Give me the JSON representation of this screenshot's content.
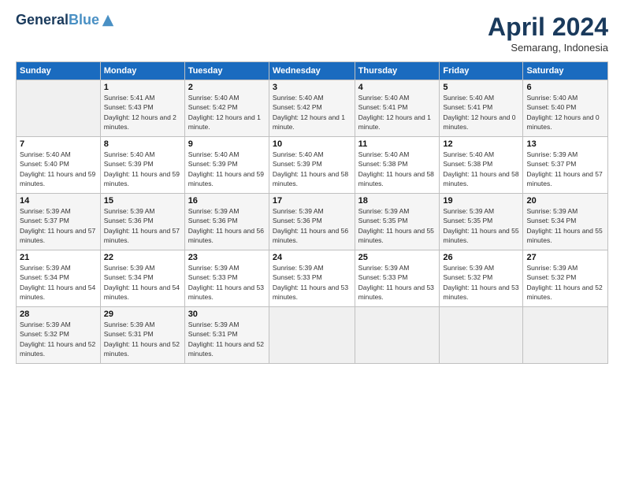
{
  "header": {
    "logo_line1": "General",
    "logo_line2": "Blue",
    "month_title": "April 2024",
    "subtitle": "Semarang, Indonesia"
  },
  "days_of_week": [
    "Sunday",
    "Monday",
    "Tuesday",
    "Wednesday",
    "Thursday",
    "Friday",
    "Saturday"
  ],
  "weeks": [
    [
      {
        "day": "",
        "sunrise": "",
        "sunset": "",
        "daylight": ""
      },
      {
        "day": "1",
        "sunrise": "5:41 AM",
        "sunset": "5:43 PM",
        "daylight": "12 hours and 2 minutes."
      },
      {
        "day": "2",
        "sunrise": "5:40 AM",
        "sunset": "5:42 PM",
        "daylight": "12 hours and 1 minute."
      },
      {
        "day": "3",
        "sunrise": "5:40 AM",
        "sunset": "5:42 PM",
        "daylight": "12 hours and 1 minute."
      },
      {
        "day": "4",
        "sunrise": "5:40 AM",
        "sunset": "5:41 PM",
        "daylight": "12 hours and 1 minute."
      },
      {
        "day": "5",
        "sunrise": "5:40 AM",
        "sunset": "5:41 PM",
        "daylight": "12 hours and 0 minutes."
      },
      {
        "day": "6",
        "sunrise": "5:40 AM",
        "sunset": "5:40 PM",
        "daylight": "12 hours and 0 minutes."
      }
    ],
    [
      {
        "day": "7",
        "sunrise": "5:40 AM",
        "sunset": "5:40 PM",
        "daylight": "11 hours and 59 minutes."
      },
      {
        "day": "8",
        "sunrise": "5:40 AM",
        "sunset": "5:39 PM",
        "daylight": "11 hours and 59 minutes."
      },
      {
        "day": "9",
        "sunrise": "5:40 AM",
        "sunset": "5:39 PM",
        "daylight": "11 hours and 59 minutes."
      },
      {
        "day": "10",
        "sunrise": "5:40 AM",
        "sunset": "5:39 PM",
        "daylight": "11 hours and 58 minutes."
      },
      {
        "day": "11",
        "sunrise": "5:40 AM",
        "sunset": "5:38 PM",
        "daylight": "11 hours and 58 minutes."
      },
      {
        "day": "12",
        "sunrise": "5:40 AM",
        "sunset": "5:38 PM",
        "daylight": "11 hours and 58 minutes."
      },
      {
        "day": "13",
        "sunrise": "5:39 AM",
        "sunset": "5:37 PM",
        "daylight": "11 hours and 57 minutes."
      }
    ],
    [
      {
        "day": "14",
        "sunrise": "5:39 AM",
        "sunset": "5:37 PM",
        "daylight": "11 hours and 57 minutes."
      },
      {
        "day": "15",
        "sunrise": "5:39 AM",
        "sunset": "5:36 PM",
        "daylight": "11 hours and 57 minutes."
      },
      {
        "day": "16",
        "sunrise": "5:39 AM",
        "sunset": "5:36 PM",
        "daylight": "11 hours and 56 minutes."
      },
      {
        "day": "17",
        "sunrise": "5:39 AM",
        "sunset": "5:36 PM",
        "daylight": "11 hours and 56 minutes."
      },
      {
        "day": "18",
        "sunrise": "5:39 AM",
        "sunset": "5:35 PM",
        "daylight": "11 hours and 55 minutes."
      },
      {
        "day": "19",
        "sunrise": "5:39 AM",
        "sunset": "5:35 PM",
        "daylight": "11 hours and 55 minutes."
      },
      {
        "day": "20",
        "sunrise": "5:39 AM",
        "sunset": "5:34 PM",
        "daylight": "11 hours and 55 minutes."
      }
    ],
    [
      {
        "day": "21",
        "sunrise": "5:39 AM",
        "sunset": "5:34 PM",
        "daylight": "11 hours and 54 minutes."
      },
      {
        "day": "22",
        "sunrise": "5:39 AM",
        "sunset": "5:34 PM",
        "daylight": "11 hours and 54 minutes."
      },
      {
        "day": "23",
        "sunrise": "5:39 AM",
        "sunset": "5:33 PM",
        "daylight": "11 hours and 53 minutes."
      },
      {
        "day": "24",
        "sunrise": "5:39 AM",
        "sunset": "5:33 PM",
        "daylight": "11 hours and 53 minutes."
      },
      {
        "day": "25",
        "sunrise": "5:39 AM",
        "sunset": "5:33 PM",
        "daylight": "11 hours and 53 minutes."
      },
      {
        "day": "26",
        "sunrise": "5:39 AM",
        "sunset": "5:32 PM",
        "daylight": "11 hours and 53 minutes."
      },
      {
        "day": "27",
        "sunrise": "5:39 AM",
        "sunset": "5:32 PM",
        "daylight": "11 hours and 52 minutes."
      }
    ],
    [
      {
        "day": "28",
        "sunrise": "5:39 AM",
        "sunset": "5:32 PM",
        "daylight": "11 hours and 52 minutes."
      },
      {
        "day": "29",
        "sunrise": "5:39 AM",
        "sunset": "5:31 PM",
        "daylight": "11 hours and 52 minutes."
      },
      {
        "day": "30",
        "sunrise": "5:39 AM",
        "sunset": "5:31 PM",
        "daylight": "11 hours and 52 minutes."
      },
      {
        "day": "",
        "sunrise": "",
        "sunset": "",
        "daylight": ""
      },
      {
        "day": "",
        "sunrise": "",
        "sunset": "",
        "daylight": ""
      },
      {
        "day": "",
        "sunrise": "",
        "sunset": "",
        "daylight": ""
      },
      {
        "day": "",
        "sunrise": "",
        "sunset": "",
        "daylight": ""
      }
    ]
  ]
}
